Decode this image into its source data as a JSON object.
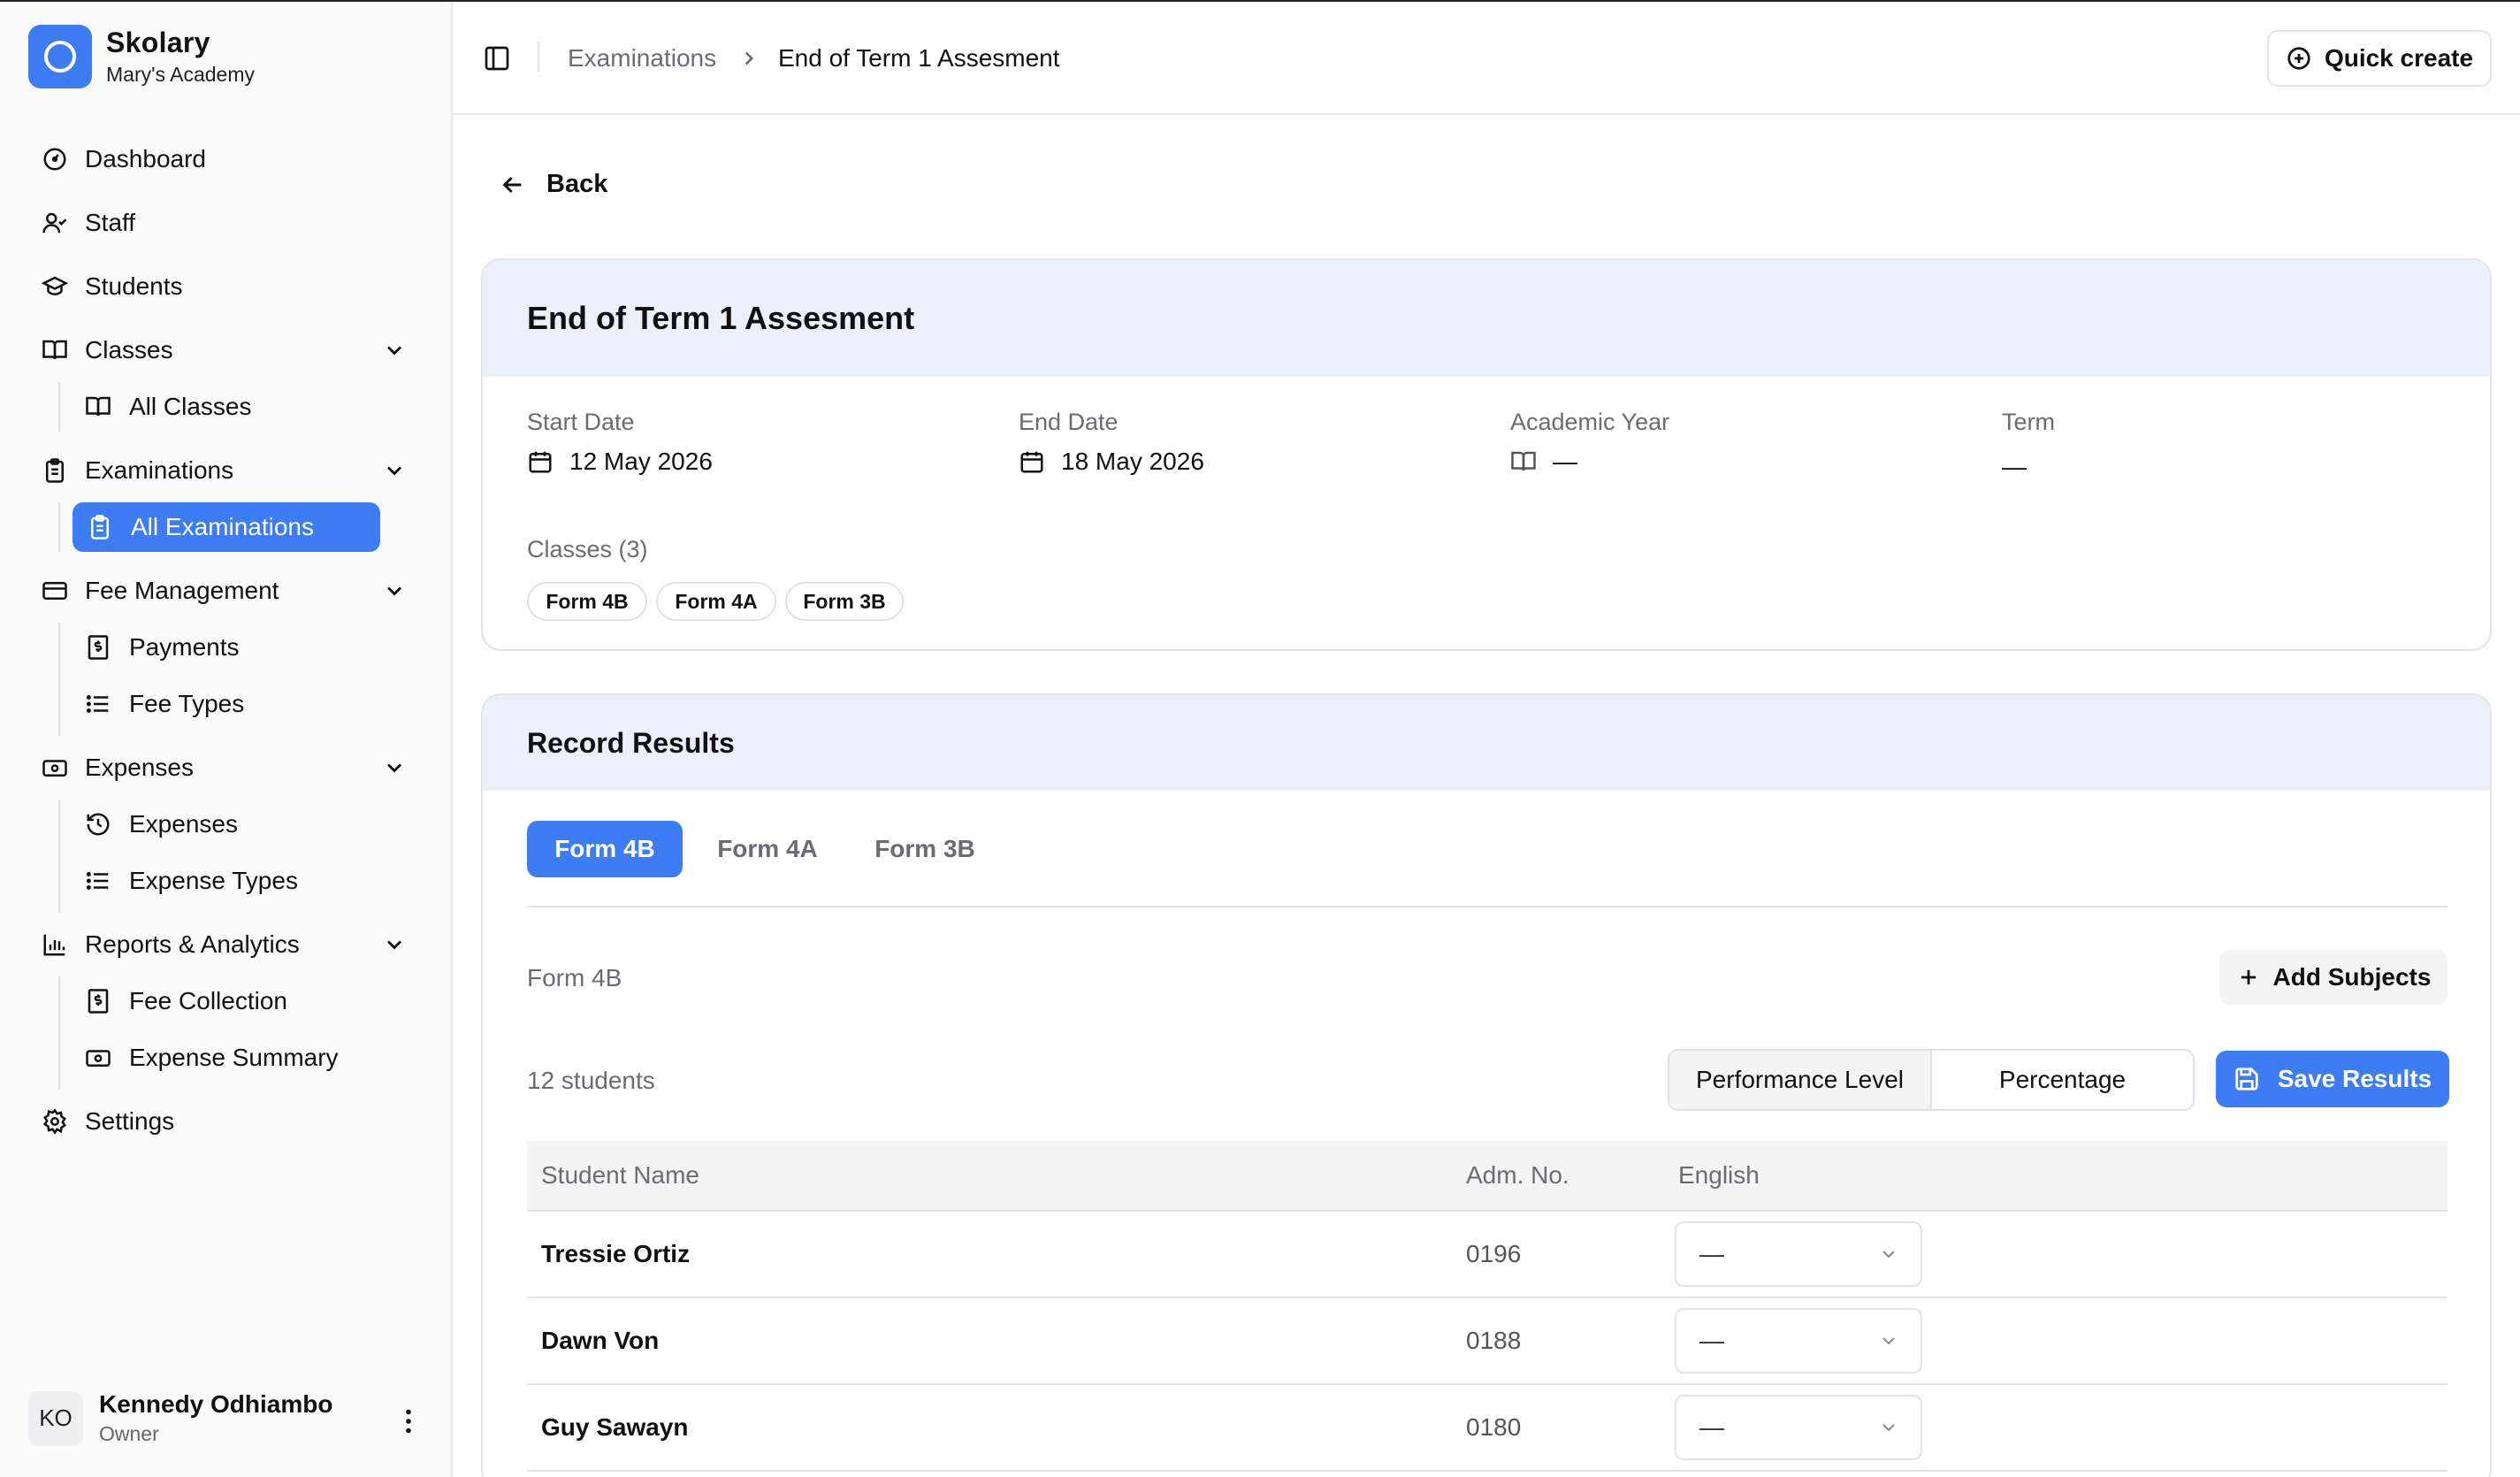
{
  "brand": {
    "name": "Skolary",
    "school": "Mary's Academy",
    "color": "#3d7cf2"
  },
  "nav": {
    "dashboard": "Dashboard",
    "staff": "Staff",
    "students": "Students",
    "classes": "Classes",
    "all_classes": "All Classes",
    "examinations": "Examinations",
    "all_examinations": "All Examinations",
    "fee_management": "Fee Management",
    "payments": "Payments",
    "fee_types": "Fee Types",
    "expenses": "Expenses",
    "expenses_sub": "Expenses",
    "expense_types": "Expense Types",
    "reports": "Reports & Analytics",
    "fee_collection": "Fee Collection",
    "expense_summary": "Expense Summary",
    "settings": "Settings"
  },
  "user": {
    "initials": "KO",
    "name": "Kennedy Odhiambo",
    "role": "Owner"
  },
  "header": {
    "breadcrumb_parent": "Examinations",
    "breadcrumb_current": "End of Term 1 Assesment",
    "quick_create": "Quick create"
  },
  "back_label": "Back",
  "exam": {
    "title": "End of Term 1 Assesment",
    "start_label": "Start Date",
    "start_value": "12 May 2026",
    "end_label": "End Date",
    "end_value": "18 May 2026",
    "year_label": "Academic Year",
    "year_value": "—",
    "term_label": "Term",
    "term_value": "—",
    "classes_label": "Classes (3)",
    "classes": [
      "Form 4B",
      "Form 4A",
      "Form 3B"
    ]
  },
  "results": {
    "title": "Record Results",
    "tabs": [
      "Form 4B",
      "Form 4A",
      "Form 3B"
    ],
    "active_tab": "Form 4B",
    "section_label": "Form 4B",
    "add_subjects": "Add Subjects",
    "student_count": "12 students",
    "mode_options": [
      "Performance Level",
      "Percentage"
    ],
    "mode_selected": "Performance Level",
    "save_label": "Save Results",
    "columns": [
      "Student Name",
      "Adm. No.",
      "English"
    ],
    "rows": [
      {
        "name": "Tressie Ortiz",
        "adm": "0196",
        "english": "—"
      },
      {
        "name": "Dawn Von",
        "adm": "0188",
        "english": "—"
      },
      {
        "name": "Guy Sawayn",
        "adm": "0180",
        "english": "—"
      }
    ]
  }
}
